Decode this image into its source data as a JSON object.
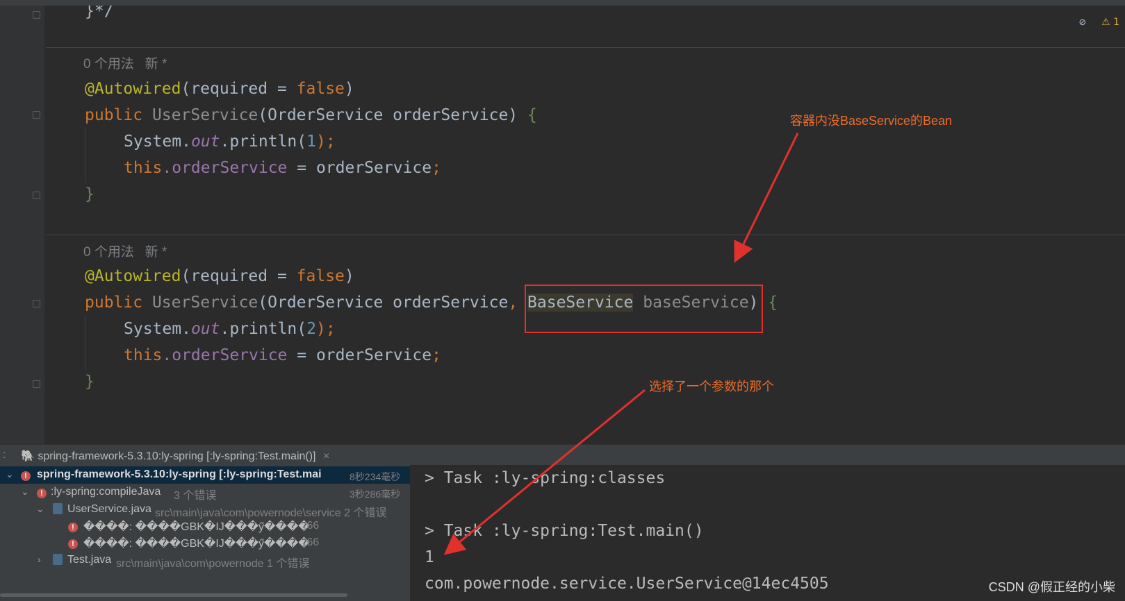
{
  "editor": {
    "top_fragment": "}*/",
    "usage_hint_1": "0 个用法   新 *",
    "usage_hint_2": "0 个用法   新 *",
    "block1": {
      "annotation": "@Autowired",
      "annotation_params_open": "(required = ",
      "annotation_value": "false",
      "annotation_params_close": ")",
      "kw_public": "public",
      "ctor_name": "UserService",
      "params": "(OrderService orderService)",
      "open_brace": "{",
      "sysout": "System.",
      "out": "out",
      "println": ".println(",
      "arg": "1",
      "println_close": ");",
      "kw_this": "this",
      "field_access": ".orderService",
      "assign": " = orderService",
      "semicolon": ";",
      "close_brace": "}"
    },
    "block2": {
      "annotation": "@Autowired",
      "annotation_params_open": "(required = ",
      "annotation_value": "false",
      "annotation_params_close": ")",
      "kw_public": "public",
      "ctor_name": "UserService",
      "params_part1": "(OrderService orderService",
      "comma": ",",
      "highlighted_type": "BaseService",
      "unused_param": "baseService",
      "params_close": ")",
      "open_brace": "{",
      "sysout": "System.",
      "out": "out",
      "println": ".println(",
      "arg": "2",
      "println_close": ");",
      "kw_this": "this",
      "field_access": ".orderService",
      "assign": " = orderService",
      "semicolon": ";",
      "close_brace": "}"
    },
    "warning_badge": "⚠ 1"
  },
  "annotations": {
    "callout_1": "容器内没BaseService的Bean",
    "callout_2": "选择了一个参数的那个"
  },
  "run_panel": {
    "tab_label": "spring-framework-5.3.10:ly-spring [:ly-spring:Test.main()]",
    "tab_close": "×",
    "tree": [
      {
        "label": "spring-framework-5.3.10:ly-spring [:ly-spring:Test.mai",
        "time": "8秒234毫秒"
      },
      {
        "label": ":ly-spring:compileJava",
        "detail": "3 个错误",
        "time": "3秒286毫秒"
      },
      {
        "label": "UserService.java",
        "detail": "src\\main\\java\\com\\powernode\\service 2 个错误"
      },
      {
        "label": "����: ����GBK�IJ���ӳ����",
        "detail": ":66"
      },
      {
        "label": "����: ����GBK�IJ���ӳ����",
        "detail": ":66"
      },
      {
        "label": "Test.java",
        "detail": "src\\main\\java\\com\\powernode 1 个错误"
      }
    ],
    "console": [
      "> Task :ly-spring:classes",
      "",
      "> Task :ly-spring:Test.main()",
      "1",
      "com.powernode.service.UserService@14ec4505"
    ]
  },
  "watermark": "CSDN @假正经的小柴"
}
